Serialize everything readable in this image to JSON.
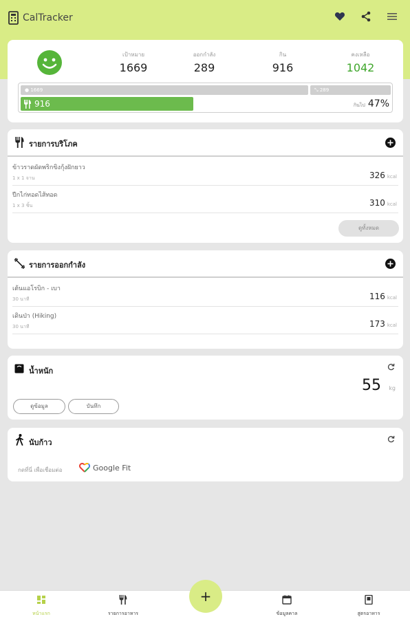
{
  "app": {
    "title": "CalTracker"
  },
  "summary": {
    "stats": [
      {
        "label": "เป้าหมาย",
        "value": "1669"
      },
      {
        "label": "ออกกำลัง",
        "value": "289"
      },
      {
        "label": "กิน",
        "value": "916"
      },
      {
        "label": "คงเหลือ",
        "value": "1042"
      }
    ],
    "bar_goal_label": "1669",
    "bar_exercise_label": "289",
    "bar_eaten_label": "916",
    "eaten_fraction": 0.47,
    "percent_prefix": "กินไป",
    "percent_label": "47%"
  },
  "meals": {
    "title": "รายการบริโภค",
    "items": [
      {
        "name": "ข้าวราดผัดพริกขิงกุ้งฝักยาว",
        "qty": "1 x 1 จาน",
        "kcal": "326",
        "unit": "kcal"
      },
      {
        "name": "ปีกไก่ทอดไส้ทอด",
        "qty": "1 x 3 ชิ้น",
        "kcal": "310",
        "unit": "kcal"
      }
    ],
    "see_all": "ดูทั้งหมด"
  },
  "exercise": {
    "title": "รายการออกกำลัง",
    "items": [
      {
        "name": "เต้นแอโรบิก - เบา",
        "qty": "30 นาที",
        "kcal": "116",
        "unit": "kcal"
      },
      {
        "name": "เดินป่า (Hiking)",
        "qty": "30 นาที",
        "kcal": "173",
        "unit": "kcal"
      }
    ]
  },
  "weight": {
    "title": "น้ำหนัก",
    "value": "55",
    "unit": "kg",
    "btn_view": "ดูข้อมูล",
    "btn_record": "บันทึก"
  },
  "steps": {
    "title": "นับก้าว",
    "connect_text": "กดที่นี่ เพื่อเชื่อมต่อ",
    "gfit_label": "Google Fit"
  },
  "nav": {
    "items": [
      {
        "label": "หน้าแรก"
      },
      {
        "label": "รายการอาหาร"
      },
      {
        "label": "ข้อมูลคาล"
      },
      {
        "label": "สูตรอาหาร"
      }
    ],
    "fab_label": "+"
  }
}
